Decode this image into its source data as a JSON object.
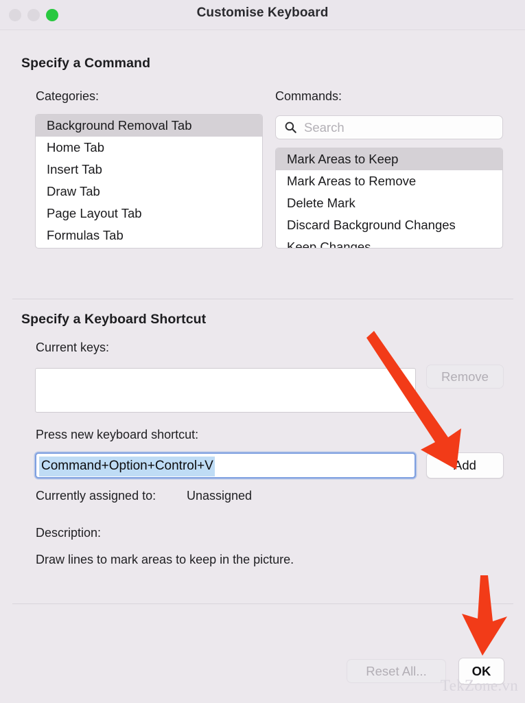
{
  "window": {
    "title": "Customise Keyboard",
    "traffic_lights": [
      {
        "name": "close",
        "state": "disabled",
        "color": "#dcd8de"
      },
      {
        "name": "minimize",
        "state": "disabled",
        "color": "#dcd8de"
      },
      {
        "name": "zoom",
        "state": "enabled",
        "color": "#28c83f"
      }
    ]
  },
  "command_section": {
    "heading": "Specify a Command",
    "categories_label": "Categories:",
    "categories": [
      {
        "label": "Background Removal Tab",
        "selected": true
      },
      {
        "label": "Home Tab",
        "selected": false
      },
      {
        "label": "Insert Tab",
        "selected": false
      },
      {
        "label": "Draw Tab",
        "selected": false
      },
      {
        "label": "Page Layout Tab",
        "selected": false
      },
      {
        "label": "Formulas Tab",
        "selected": false
      }
    ],
    "commands_label": "Commands:",
    "search": {
      "placeholder": "Search",
      "value": "",
      "icon": "search-icon"
    },
    "commands": [
      {
        "label": "Mark Areas to Keep",
        "selected": true
      },
      {
        "label": "Mark Areas to Remove",
        "selected": false
      },
      {
        "label": "Delete Mark",
        "selected": false
      },
      {
        "label": "Discard Background Changes",
        "selected": false
      },
      {
        "label": "Keep Changes",
        "selected": false
      }
    ]
  },
  "shortcut_section": {
    "heading": "Specify a Keyboard Shortcut",
    "current_keys_label": "Current keys:",
    "current_keys_value": "",
    "remove_button": {
      "label": "Remove",
      "enabled": false
    },
    "press_new_label": "Press new keyboard shortcut:",
    "new_shortcut_value": "Command+Option+Control+V",
    "new_shortcut_selected": true,
    "add_button": {
      "label": "Add",
      "enabled": true
    },
    "assigned_label": "Currently assigned to:",
    "assigned_value": "Unassigned",
    "description_label": "Description:",
    "description_value": "Draw lines to mark areas to keep in the picture."
  },
  "footer": {
    "reset_button": {
      "label": "Reset All...",
      "enabled": false
    },
    "ok_button": {
      "label": "OK",
      "enabled": true
    }
  },
  "annotations": {
    "arrow_color": "#f23b18",
    "arrow_to_add": "points down-right at the Add button",
    "arrow_to_ok": "points down at the OK button"
  },
  "watermark": {
    "text": "TekZone.vn"
  }
}
